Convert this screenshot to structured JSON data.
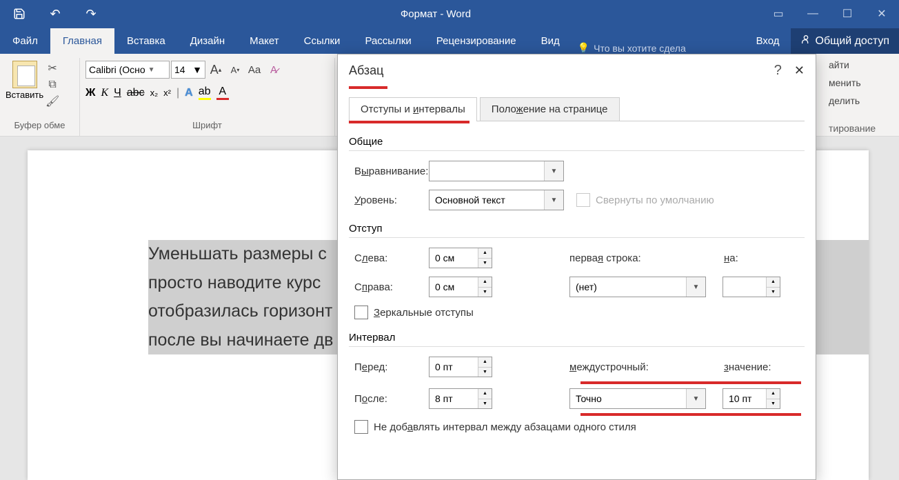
{
  "title": "Формат - Word",
  "tabs": [
    "Файл",
    "Главная",
    "Вставка",
    "Дизайн",
    "Макет",
    "Ссылки",
    "Рассылки",
    "Рецензирование",
    "Вид"
  ],
  "tell_me": "Что вы хотите сдела",
  "signin": "Вход",
  "share": "Общий доступ",
  "clipboard": {
    "paste": "Вставить",
    "group": "Буфер обме"
  },
  "font": {
    "name": "Calibri (Осно",
    "size": "14",
    "group": "Шрифт",
    "bold": "Ж",
    "italic": "К",
    "underline": "Ч",
    "strike": "abc",
    "sub": "x₂",
    "sup": "x²"
  },
  "right_panel": {
    "find": "айти",
    "replace": "менить",
    "select": "делить",
    "group": "тирование"
  },
  "doc_lines": [
    "Уменьшать размеры с",
    "просто   наводите   курс",
    "отобразилась горизонт",
    "после вы начинаете дв"
  ],
  "dialog": {
    "title": "Абзац",
    "tabs": [
      "Отступы и интервалы",
      "Положение на странице"
    ],
    "general": {
      "heading": "Общие",
      "align_label": "Выравнивание:",
      "level_label": "Уровень:",
      "level_value": "Основной текст",
      "collapsed": "Свернуты по умолчанию"
    },
    "indent": {
      "heading": "Отступ",
      "left_label": "Слева:",
      "left_value": "0 см",
      "right_label": "Справа:",
      "right_value": "0 см",
      "first_label": "первая строка:",
      "first_value": "(нет)",
      "by_label": "на:",
      "mirror": "Зеркальные отступы"
    },
    "spacing": {
      "heading": "Интервал",
      "before_label": "Перед:",
      "before_value": "0 пт",
      "after_label": "После:",
      "after_value": "8 пт",
      "line_label": "междустрочный:",
      "line_value": "Точно",
      "at_label": "значение:",
      "at_value": "10 пт",
      "noadd": "Не добавлять интервал между абзацами одного стиля"
    }
  }
}
